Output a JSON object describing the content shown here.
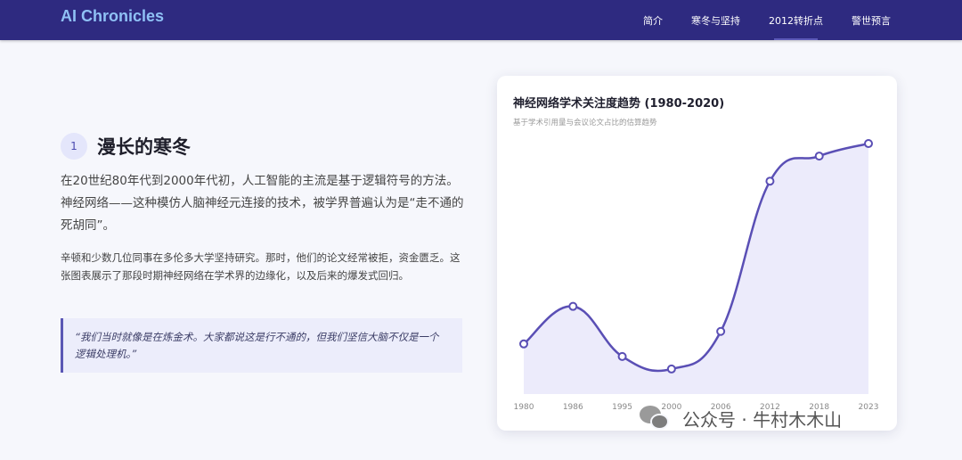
{
  "brand": "AI Chronicles",
  "nav": [
    "简介",
    "寒冬与坚持",
    "2012转折点",
    "警世预言"
  ],
  "section": {
    "number": "1",
    "title": "漫长的寒冬",
    "lead": "在20世纪80年代到2000年代初，人工智能的主流是基于逻辑符号的方法。神经网络——这种模仿人脑神经元连接的技术，被学界普遍认为是“走不通的死胡同”。",
    "body": "辛顿和少数几位同事在多伦多大学坚持研究。那时，他们的论文经常被拒，资金匮乏。这张图表展示了那段时期神经网络在学术界的边缘化，以及后来的爆发式回归。",
    "quote": "“我们当时就像是在炼金术。大家都说这是行不通的，但我们坚信大脑不仅是一个逻辑处理机。”"
  },
  "chart": {
    "title": "神经网络学术关注度趋势 (1980-2020)",
    "subtitle": "基于学术引用量与会议论文占比的估算趋势"
  },
  "chart_data": {
    "type": "area",
    "x": [
      "1980",
      "1986",
      "1995",
      "2000",
      "2006",
      "2012",
      "2018",
      "2023"
    ],
    "values": [
      20,
      35,
      15,
      10,
      25,
      85,
      95,
      100
    ],
    "ylim": [
      0,
      105
    ],
    "grid": false,
    "colors": {
      "line": "#5a4fb5",
      "fill": "#ecebfb",
      "point_fill": "#ffffff"
    }
  },
  "watermark": "公众号 · 牛村木木山",
  "icons": {
    "watermark": "wechat-icon"
  }
}
